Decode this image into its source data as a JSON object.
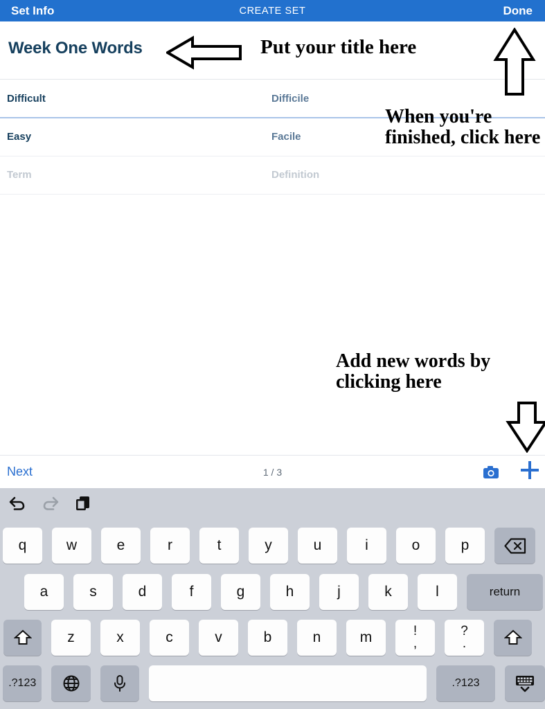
{
  "navbar": {
    "left_label": "Set Info",
    "title": "CREATE SET",
    "right_label": "Done",
    "background_color": "#2271ce",
    "text_color": "#ffffff"
  },
  "set": {
    "title": "Week One Words",
    "title_color": "#16405e"
  },
  "cards": {
    "rows": [
      {
        "term": "Difficult",
        "definition": "Difficile",
        "is_placeholder": false
      },
      {
        "term": "Easy",
        "definition": "Facile",
        "is_placeholder": false
      },
      {
        "term": "Term",
        "definition": "Definition",
        "is_placeholder": true
      }
    ]
  },
  "annotations": {
    "title_hint": "Put your title here",
    "done_hint": "When you're finished, click here",
    "add_hint": "Add new words by clicking here",
    "arrow_left": "arrow-left-icon",
    "arrow_up": "arrow-up-icon",
    "arrow_down": "arrow-down-icon"
  },
  "accessory_bar": {
    "next_label": "Next",
    "counter": "1 / 3",
    "camera_icon": "camera-icon",
    "add_icon": "plus-icon",
    "accent_color": "#2a6fd0"
  },
  "keyboard": {
    "tools": [
      {
        "name": "undo-icon",
        "glyph": "↶",
        "enabled": true
      },
      {
        "name": "redo-icon",
        "glyph": "↷",
        "enabled": false
      },
      {
        "name": "paste-icon",
        "glyph": "❐",
        "enabled": true
      }
    ],
    "row1": [
      "q",
      "w",
      "e",
      "r",
      "t",
      "y",
      "u",
      "i",
      "o",
      "p"
    ],
    "backspace_label": "⌫",
    "row2": [
      "a",
      "s",
      "d",
      "f",
      "g",
      "h",
      "j",
      "k",
      "l"
    ],
    "return_label": "return",
    "shift_label": "⇧",
    "row3": [
      "z",
      "x",
      "c",
      "v",
      "b",
      "n",
      "m"
    ],
    "punct1_top": "!",
    "punct1_bottom": ",",
    "punct2_top": "?",
    "punct2_bottom": ".",
    "numeric_label": ".?123",
    "globe_label": "⊕",
    "mic_label": "Ʀ",
    "space_label": "",
    "hide_label": "⌨",
    "background_color": "#ccd0d8"
  }
}
